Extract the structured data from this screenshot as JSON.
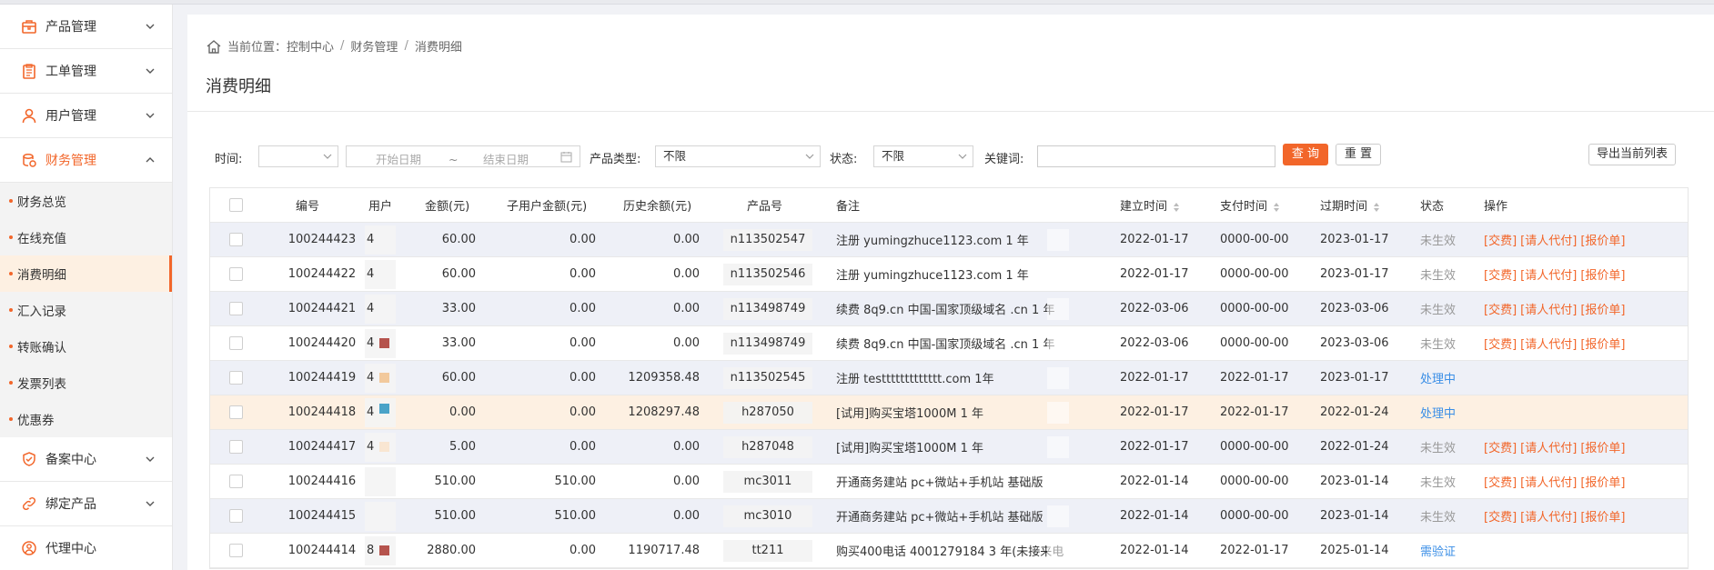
{
  "sidebar": {
    "menus": [
      {
        "label": "产品管理",
        "icon": "product-icon",
        "expanded": false
      },
      {
        "label": "工单管理",
        "icon": "clipboard-icon",
        "expanded": false
      },
      {
        "label": "用户管理",
        "icon": "user-icon",
        "expanded": false
      },
      {
        "label": "财务管理",
        "icon": "finance-icon",
        "expanded": true
      }
    ],
    "finance_items": [
      {
        "label": "财务总览"
      },
      {
        "label": "在线充值"
      },
      {
        "label": "消费明细",
        "active": true
      },
      {
        "label": "汇入记录"
      },
      {
        "label": "转账确认"
      },
      {
        "label": "发票列表"
      },
      {
        "label": "优惠券"
      }
    ],
    "menus_after": [
      {
        "label": "备案中心",
        "icon": "shield-icon"
      },
      {
        "label": "绑定产品",
        "icon": "link-icon"
      },
      {
        "label": "代理中心",
        "icon": "agent-icon"
      }
    ]
  },
  "breadcrumb": {
    "prefix": "当前位置：",
    "items": [
      "控制中心",
      "财务管理",
      "消费明细"
    ],
    "separator": "/"
  },
  "page_title": "消费明细",
  "filters": {
    "time_label": "时间:",
    "time_value": "",
    "start_placeholder": "开始日期",
    "range_sep": "~",
    "end_placeholder": "结束日期",
    "type_label": "产品类型:",
    "type_value": "不限",
    "status_label": "状态:",
    "status_value": "不限",
    "keyword_label": "关键词:",
    "keyword_value": "",
    "query_button": "查 询",
    "reset_button": "重 置",
    "export_button": "导出当前列表"
  },
  "table": {
    "headers": {
      "id": "编号",
      "user": "用户",
      "amount": "金额(元)",
      "sub_amount": "子用户金额(元)",
      "history": "历史余额(元)",
      "product": "产品号",
      "note": "备注",
      "created": "建立时间",
      "paid": "支付时间",
      "expire": "过期时间",
      "status": "状态",
      "ops": "操作"
    },
    "rows": [
      {
        "id": "100244423",
        "user": "4",
        "amount": "60.00",
        "sub_amount": "0.00",
        "history": "0.00",
        "product": "n113502547",
        "note": "注册 yumingzhuce1123.com  1 年",
        "created": "2022-01-17",
        "paid": "0000-00-00",
        "expire": "2023-01-17",
        "status": "未生效",
        "status_color": "gray",
        "ops": [
          "[交费]",
          "[请人代付]",
          "[报价单]"
        ]
      },
      {
        "id": "100244422",
        "user": "4",
        "amount": "60.00",
        "sub_amount": "0.00",
        "history": "0.00",
        "product": "n113502546",
        "note": "注册 yumingzhuce1123.com  1 年",
        "created": "2022-01-17",
        "paid": "0000-00-00",
        "expire": "2023-01-17",
        "status": "未生效",
        "status_color": "gray",
        "ops": [
          "[交费]",
          "[请人代付]",
          "[报价单]"
        ]
      },
      {
        "id": "100244421",
        "user": "4",
        "amount": "33.00",
        "sub_amount": "0.00",
        "history": "0.00",
        "product": "n113498749",
        "note": "续费 8q9.cn 中国-国家顶级域名 .cn    1 年",
        "created": "2022-03-06",
        "paid": "0000-00-00",
        "expire": "2023-03-06",
        "status": "未生效",
        "status_color": "gray",
        "ops": [
          "[交费]",
          "[请人代付]",
          "[报价单]"
        ]
      },
      {
        "id": "100244420",
        "user": "4",
        "amount": "33.00",
        "sub_amount": "0.00",
        "history": "0.00",
        "product": "n113498749",
        "note": "续费 8q9.cn 中国-国家顶级域名 .cn 1 年",
        "created": "2022-03-06",
        "paid": "0000-00-00",
        "expire": "2023-03-06",
        "status": "未生效",
        "status_color": "gray",
        "ops": [
          "[交费]",
          "[请人代付]",
          "[报价单]"
        ]
      },
      {
        "id": "100244419",
        "user": "4",
        "amount": "60.00",
        "sub_amount": "0.00",
        "history": "1209358.48",
        "product": "n113502545",
        "note": "注册 testtttttttttttt.com 1年",
        "created": "2022-01-17",
        "paid": "2022-01-17",
        "expire": "2023-01-17",
        "status": "处理中",
        "status_color": "blue",
        "ops": []
      },
      {
        "id": "100244418",
        "user": "4",
        "amount": "0.00",
        "sub_amount": "0.00",
        "history": "1208297.48",
        "product": "h287050",
        "note": "[试用]购买宝塔1000M 1 年",
        "created": "2022-01-17",
        "paid": "2022-01-17",
        "expire": "2022-01-24",
        "status": "处理中",
        "status_color": "blue",
        "ops": []
      },
      {
        "id": "100244417",
        "user": "4",
        "amount": "5.00",
        "sub_amount": "0.00",
        "history": "0.00",
        "product": "h287048",
        "note": "[试用]购买宝塔1000M 1 年",
        "created": "2022-01-17",
        "paid": "0000-00-00",
        "expire": "2022-01-24",
        "status": "未生效",
        "status_color": "gray",
        "ops": [
          "[交费]",
          "[请人代付]",
          "[报价单]"
        ]
      },
      {
        "id": "100244416",
        "user": "",
        "amount": "510.00",
        "sub_amount": "510.00",
        "history": "0.00",
        "product": "mc3011",
        "note": "开通商务建站 pc+微站+手机站  基础版",
        "created": "2022-01-14",
        "paid": "0000-00-00",
        "expire": "2023-01-14",
        "status": "未生效",
        "status_color": "gray",
        "ops": [
          "[交费]",
          "[请人代付]",
          "[报价单]"
        ]
      },
      {
        "id": "100244415",
        "user": "",
        "amount": "510.00",
        "sub_amount": "510.00",
        "history": "0.00",
        "product": "mc3010",
        "note": "开通商务建站 pc+微站+手机站  基础版",
        "created": "2022-01-14",
        "paid": "0000-00-00",
        "expire": "2023-01-14",
        "status": "未生效",
        "status_color": "gray",
        "ops": [
          "[交费]",
          "[请人代付]",
          "[报价单]"
        ]
      },
      {
        "id": "100244414",
        "user": "8",
        "amount": "2880.00",
        "sub_amount": "0.00",
        "history": "1190717.48",
        "product": "tt211",
        "note": "购买400电话 4001279184 3 年(未接来电",
        "created": "2022-01-14",
        "paid": "2022-01-17",
        "expire": "2025-01-14",
        "status": "需验证",
        "status_color": "blue",
        "ops": []
      }
    ]
  },
  "colors": {
    "accent": "#f2662a",
    "link_blue": "#3a8ee6",
    "row_alt": "#eef0f7",
    "row_highlight": "#fdf0e2"
  }
}
